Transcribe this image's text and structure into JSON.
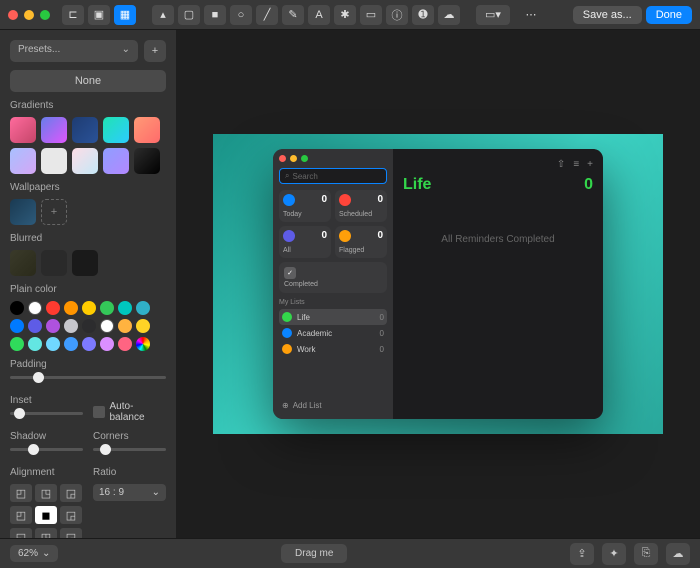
{
  "toolbar": {
    "save_as": "Save as...",
    "done": "Done"
  },
  "sidebar": {
    "presets_label": "Presets...",
    "none_label": "None",
    "gradients_title": "Gradients",
    "gradients": [
      "linear-gradient(135deg,#ff6b9d,#c44569)",
      "linear-gradient(135deg,#667eea,#e056fd)",
      "linear-gradient(135deg,#1e3c72,#2a5298)",
      "linear-gradient(135deg,#20e3b2,#2cccff)",
      "linear-gradient(135deg,#ff9a76,#ff6b6b)",
      "linear-gradient(135deg,#a8c0ff,#d5a6f5)",
      "#e8e8e8",
      "linear-gradient(135deg,#fddde6,#c5e8f7)",
      "linear-gradient(135deg,#8e9eff,#b388ff)",
      "linear-gradient(135deg,#2c2c2c,#000)"
    ],
    "wallpapers_title": "Wallpapers",
    "blurred_title": "Blurred",
    "plain_title": "Plain color",
    "plain_colors": [
      "#000",
      "#fff",
      "#ff3b30",
      "#ff9500",
      "#ffcc00",
      "#34c759",
      "#00c7be",
      "#30b0c7",
      "#007aff",
      "#5e5ce6",
      "#af52de",
      "#c7c7cc",
      "#2c2c2e",
      "#fff",
      "#ffb340",
      "#ffd426",
      "#30db5b",
      "#63e6e2",
      "#70d7ff",
      "#409cff",
      "#7d7aff",
      "#da8fff",
      "#ff6482",
      "#multicolor"
    ],
    "padding_title": "Padding",
    "padding_value": 15,
    "inset_title": "Inset",
    "inset_value": 5,
    "autobalance_label": "Auto-balance",
    "shadow_title": "Shadow",
    "shadow_value": 25,
    "corners_title": "Corners",
    "corners_value": 10,
    "alignment_title": "Alignment",
    "ratio_title": "Ratio",
    "ratio_value": "16 : 9"
  },
  "reminders": {
    "search_placeholder": "Search",
    "smart": [
      {
        "label": "Today",
        "count": 0,
        "color": "#0a84ff"
      },
      {
        "label": "Scheduled",
        "count": 0,
        "color": "#ff453a"
      },
      {
        "label": "All",
        "count": 0,
        "color": "#5e5ce6"
      },
      {
        "label": "Flagged",
        "count": 0,
        "color": "#ff9f0a"
      }
    ],
    "completed_label": "Completed",
    "my_lists_label": "My Lists",
    "lists": [
      {
        "name": "Life",
        "count": 0,
        "color": "#33d74b",
        "selected": true
      },
      {
        "name": "Academic",
        "count": 0,
        "color": "#0a84ff",
        "selected": false
      },
      {
        "name": "Work",
        "count": 0,
        "color": "#ff9f0a",
        "selected": false
      }
    ],
    "add_list_label": "Add List",
    "main_title": "Life",
    "main_count": 0,
    "empty_text": "All Reminders Completed"
  },
  "bottombar": {
    "zoom": "62%",
    "drag_label": "Drag me"
  }
}
